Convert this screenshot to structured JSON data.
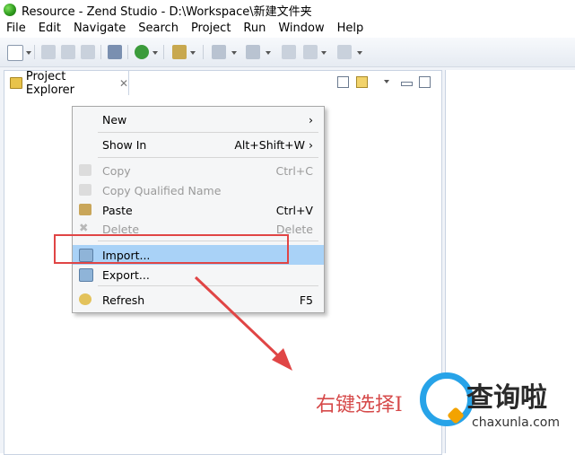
{
  "window": {
    "title": "Resource - Zend Studio - D:\\Workspace\\新建文件夹"
  },
  "menubar": [
    "File",
    "Edit",
    "Navigate",
    "Search",
    "Project",
    "Run",
    "Window",
    "Help"
  ],
  "explorer": {
    "tab_label": "Project Explorer",
    "close_glyph": "✕"
  },
  "context_menu": {
    "items": [
      {
        "label": "New",
        "accel": "›",
        "disabled": false,
        "icon": ""
      },
      {
        "label": "Show In",
        "accel": "Alt+Shift+W ›",
        "disabled": false,
        "icon": ""
      },
      {
        "label": "Copy",
        "accel": "Ctrl+C",
        "disabled": true,
        "icon": "copy-icon"
      },
      {
        "label": "Copy Qualified Name",
        "accel": "",
        "disabled": true,
        "icon": "copy-qualified-icon"
      },
      {
        "label": "Paste",
        "accel": "Ctrl+V",
        "disabled": false,
        "icon": "paste-icon"
      },
      {
        "label": "Delete",
        "accel": "Delete",
        "disabled": true,
        "icon": "delete-icon"
      },
      {
        "label": "Import...",
        "accel": "",
        "disabled": false,
        "icon": "import-icon",
        "highlighted": true
      },
      {
        "label": "Export...",
        "accel": "",
        "disabled": false,
        "icon": "export-icon"
      },
      {
        "label": "Refresh",
        "accel": "F5",
        "disabled": false,
        "icon": "refresh-icon"
      }
    ]
  },
  "annotation": {
    "text": "右键选择I",
    "color": "#d64a4a"
  },
  "watermark": {
    "name": "查询啦",
    "domain": "chaxunla.com"
  },
  "colors": {
    "highlight": "#a9d2f7",
    "arrow": "#e04545",
    "logo_blue": "#27a3e8",
    "logo_orange": "#f3a300"
  }
}
